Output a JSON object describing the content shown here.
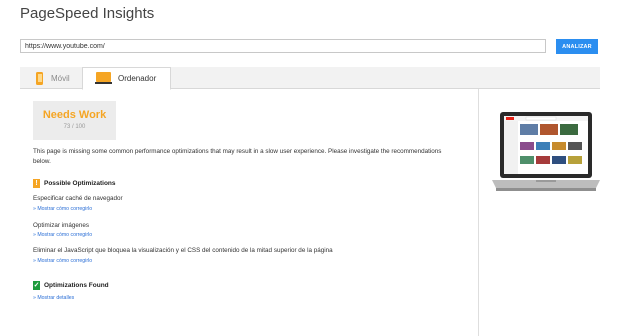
{
  "app": {
    "title": "PageSpeed Insights"
  },
  "search": {
    "url_value": "https://www.youtube.com/",
    "analyze_label": "ANALIZAR"
  },
  "tabs": [
    {
      "label": "Móvil",
      "icon": "phone-icon",
      "active": false
    },
    {
      "label": "Ordenador",
      "icon": "monitor-icon",
      "active": true
    }
  ],
  "score": {
    "label": "Needs Work",
    "value": "73 / 100",
    "color": "#f5a524"
  },
  "summary": "This page is missing some common performance optimizations that may result in a slow user experience. Please investigate the recommendations below.",
  "possible_optimizations": {
    "heading": "Possible Optimizations",
    "icon": "warning-icon",
    "items": [
      {
        "title": "Especificar caché de navegador",
        "link": "» Mostrar cómo corregirlo"
      },
      {
        "title": "Optimizar imágenes",
        "link": "» Mostrar cómo corregirlo"
      },
      {
        "title": "Eliminar el JavaScript que bloquea la visualización y el CSS del contenido de la mitad superior de la página",
        "link": "» Mostrar cómo corregirlo"
      }
    ]
  },
  "optimizations_found": {
    "heading": "Optimizations Found",
    "icon": "check-icon",
    "link": "» Mostrar detalles"
  },
  "colors": {
    "accent": "#2b8ef0",
    "warning": "#f5a524",
    "success": "#1e9b3d",
    "link": "#2b6fd6"
  }
}
